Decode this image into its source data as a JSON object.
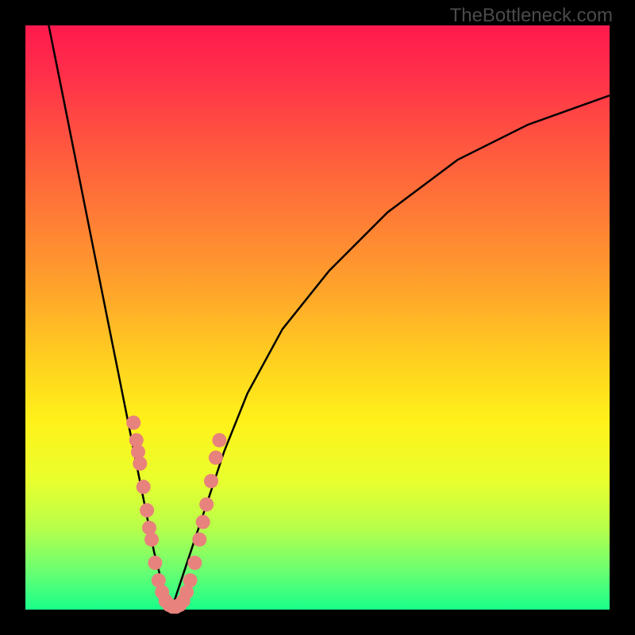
{
  "watermark": "TheBottleneck.com",
  "chart_data": {
    "type": "line",
    "title": "",
    "xlabel": "",
    "ylabel": "",
    "xlim": [
      0,
      100
    ],
    "ylim": [
      0,
      100
    ],
    "background_gradient": {
      "top_color": "#ff1a4d",
      "bottom_color": "#1aff8a",
      "meaning": "bottleneck severity, red=high, green=low"
    },
    "curves": [
      {
        "name": "left-branch",
        "stroke": "#000000",
        "x": [
          4,
          6,
          8,
          10,
          12,
          14,
          16,
          18,
          19,
          20,
          21,
          22,
          23,
          24,
          25
        ],
        "y": [
          100,
          90,
          80,
          70,
          60,
          50,
          40,
          30,
          25,
          20,
          15,
          10,
          6,
          3,
          0
        ]
      },
      {
        "name": "right-branch",
        "stroke": "#000000",
        "x": [
          25,
          27,
          29,
          31,
          34,
          38,
          44,
          52,
          62,
          74,
          86,
          100
        ],
        "y": [
          0,
          6,
          12,
          18,
          27,
          37,
          48,
          58,
          68,
          77,
          83,
          88
        ]
      }
    ],
    "scatter": {
      "name": "data-points",
      "color": "#e8827c",
      "radius": 9,
      "points": [
        {
          "x": 18.5,
          "y": 32
        },
        {
          "x": 19.0,
          "y": 29
        },
        {
          "x": 19.3,
          "y": 27
        },
        {
          "x": 19.6,
          "y": 25
        },
        {
          "x": 20.2,
          "y": 21
        },
        {
          "x": 20.8,
          "y": 17
        },
        {
          "x": 21.2,
          "y": 14
        },
        {
          "x": 21.6,
          "y": 12
        },
        {
          "x": 22.2,
          "y": 8
        },
        {
          "x": 22.8,
          "y": 5
        },
        {
          "x": 23.4,
          "y": 3
        },
        {
          "x": 24.0,
          "y": 1.5
        },
        {
          "x": 24.6,
          "y": 0.8
        },
        {
          "x": 25.2,
          "y": 0.5
        },
        {
          "x": 25.8,
          "y": 0.5
        },
        {
          "x": 26.4,
          "y": 0.8
        },
        {
          "x": 27.0,
          "y": 1.5
        },
        {
          "x": 27.6,
          "y": 3
        },
        {
          "x": 28.2,
          "y": 5
        },
        {
          "x": 29.0,
          "y": 8
        },
        {
          "x": 29.8,
          "y": 12
        },
        {
          "x": 30.4,
          "y": 15
        },
        {
          "x": 31.0,
          "y": 18
        },
        {
          "x": 31.8,
          "y": 22
        },
        {
          "x": 32.6,
          "y": 26
        },
        {
          "x": 33.2,
          "y": 29
        }
      ]
    }
  }
}
